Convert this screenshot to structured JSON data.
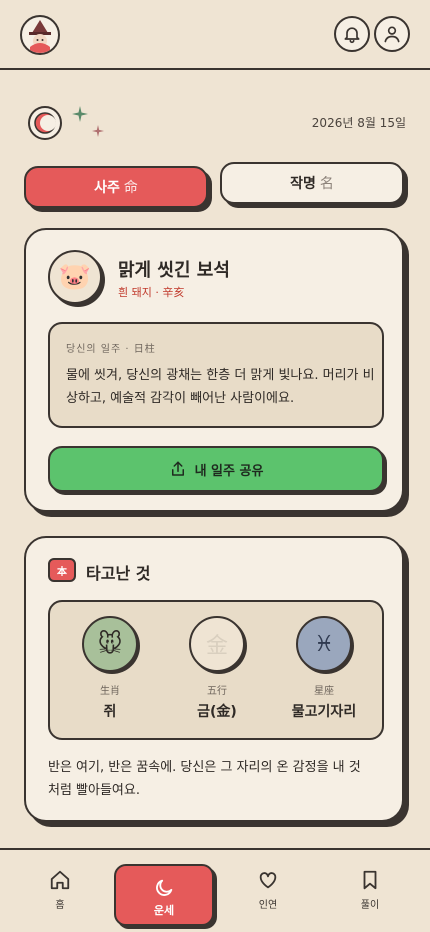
{
  "header": {
    "logo_icon": "fortune-teller-logo-icon",
    "bell_icon": "bell-icon",
    "user_icon": "user-icon"
  },
  "topline": {
    "date": "2026년 8월 15일"
  },
  "tabs": [
    {
      "label": "사주",
      "hanja": "命",
      "active": true
    },
    {
      "label": "작명",
      "hanja": "名",
      "active": false
    }
  ],
  "ilju_card": {
    "title": "맑게 씻긴 보석",
    "subtitle": "흰 돼지 · 辛亥",
    "avatar": "🐷",
    "box_label": "당신의 일주 · 日柱",
    "description": "물에 씻겨, 당신의 광채는 한층 더 맑게 빛나요. 머리가 비상하고, 예술적 감각이 빼어난 사람이에요.",
    "share_label": "내 일주 공유"
  },
  "innate_card": {
    "badge": "本",
    "title": "타고난 것",
    "items": [
      {
        "label": "生肖",
        "value": "쥐",
        "icon": "🐭"
      },
      {
        "label": "五行",
        "value": "금(金)",
        "icon": "金"
      },
      {
        "label": "星座",
        "value": "물고기자리",
        "icon": "♓︎"
      }
    ],
    "description": "반은 여기, 반은 꿈속에. 당신은 그 자리의 온 감정을 내 것처럼 빨아들여요."
  },
  "nav": {
    "home": "홈",
    "unse": "운세",
    "inyeon": "인연",
    "puri": "풀이"
  },
  "colors": {
    "background": "#efe4d3",
    "accent_red": "#e55a5a",
    "accent_green": "#5cc36d",
    "ink": "#3a3430"
  }
}
